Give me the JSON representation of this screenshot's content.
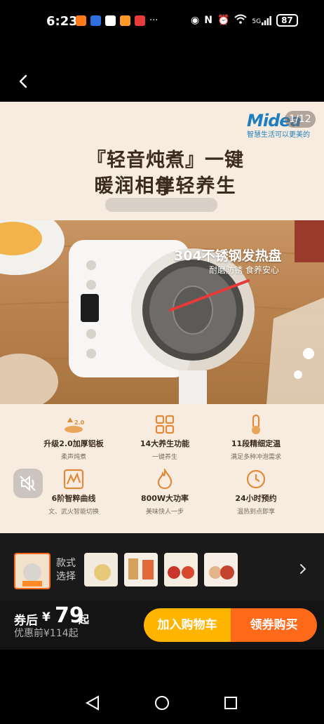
{
  "status_bar": {
    "time": "6:23",
    "more": "···",
    "network": "5G",
    "battery": "87"
  },
  "hero": {
    "counter": "1/12",
    "brand": "Midea",
    "brand_slogan": "智慧生活可以更美的",
    "headline_line1": "『轻音炖煮』一键享",
    "headline_line2": "暖润相伴轻养生",
    "photo_label": "304不锈钢发热盘",
    "photo_sublabel": "耐磨防锈  食养安心"
  },
  "features": [
    {
      "title": "升级2.0加厚铝板",
      "sub": "柔声炖煮",
      "icon": "upgrade-plate-icon"
    },
    {
      "title": "14大养生功能",
      "sub": "一键养生",
      "icon": "grid-functions-icon"
    },
    {
      "title": "11段精细定温",
      "sub": "满足多种冲泡需求",
      "icon": "thermometer-icon"
    },
    {
      "title": "6阶智粹曲线",
      "sub": "文、武火智能切换",
      "icon": "curve-chart-icon"
    },
    {
      "title": "800W大功率",
      "sub": "美味快人一步",
      "icon": "flame-icon"
    },
    {
      "title": "24小时预约",
      "sub": "温热到点即享",
      "icon": "clock-icon"
    }
  ],
  "style_selector": {
    "label": "款式选择"
  },
  "buy_bar": {
    "coupon_label": "券后",
    "currency": "¥",
    "price": "79",
    "price_suffix": "起",
    "original": "优惠前¥114起",
    "add_cart": "加入购物车",
    "buy_now": "领券购买"
  },
  "colors": {
    "accent_yellow": "#ffb400",
    "accent_orange": "#ff6a1a",
    "brand_blue": "#1d7ec0"
  }
}
